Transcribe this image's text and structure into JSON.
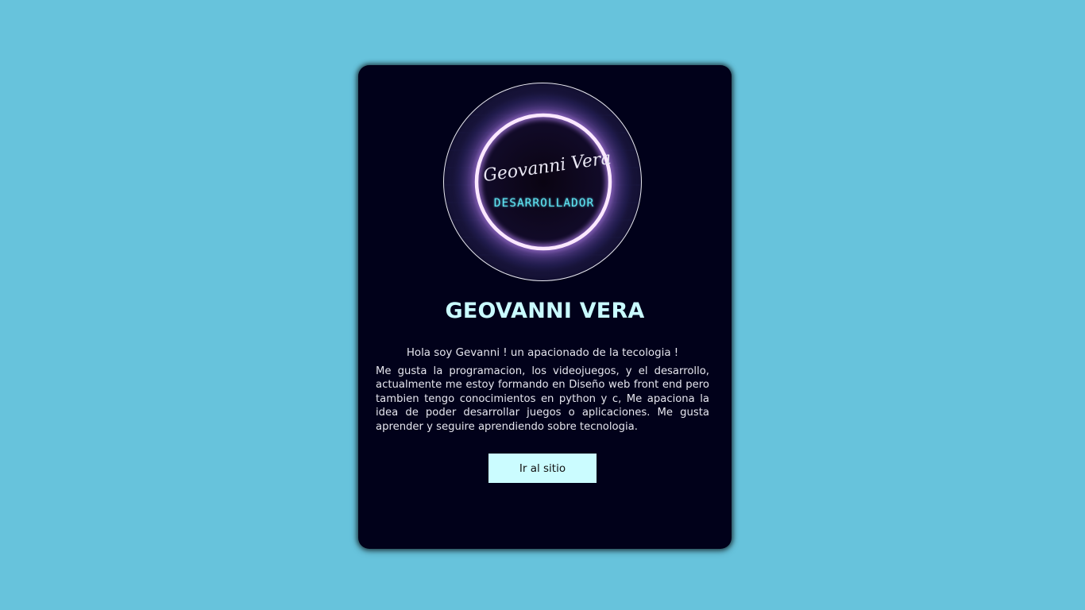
{
  "profile": {
    "avatar_signature": "Geovanni Vera",
    "avatar_role": "DESARROLLADOR",
    "name": "GEOVANNI VERA",
    "intro": "Hola soy Gevanni ! un apacionado de la tecologia !",
    "description": "Me gusta la programacion, los videojuegos, y el desarrollo, actualmente me estoy formando en Diseño web front end pero tambien tengo conocimientos en python y c, Me apaciona la idea de poder desarrollar juegos o aplicaciones. Me gusta aprender y seguire aprendiendo sobre tecnologia.",
    "button_label": "Ir al sitio"
  },
  "colors": {
    "background": "#67c3dc",
    "card": "#01011a",
    "name": "#c9fbff",
    "button": "#cbfcff",
    "neon_ring": "#fbe8ff",
    "neon_text": "#5fe6f5"
  }
}
